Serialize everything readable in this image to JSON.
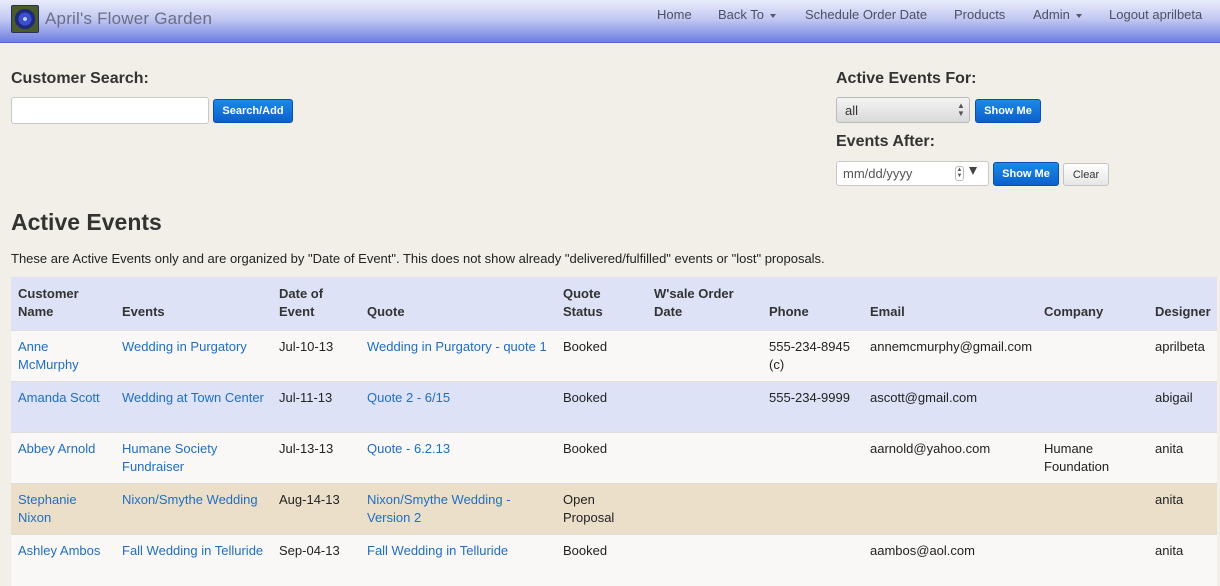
{
  "app": {
    "title": "April's Flower Garden"
  },
  "nav": {
    "home": "Home",
    "back_to": "Back To",
    "schedule": "Schedule Order Date",
    "products": "Products",
    "admin": "Admin",
    "logout": "Logout aprilbeta"
  },
  "customer_search": {
    "label": "Customer Search:",
    "value": "",
    "button": "Search/Add"
  },
  "active_events_for": {
    "label": "Active Events For:",
    "selected": "all",
    "button": "Show Me"
  },
  "events_after": {
    "label": "Events After:",
    "placeholder": "mm/dd/yyyy",
    "show_button": "Show Me",
    "clear_button": "Clear"
  },
  "page": {
    "title": "Active Events",
    "description": "These are Active Events only and are organized by \"Date of Event\". This does not show already \"delivered/fulfilled\" events or \"lost\" proposals."
  },
  "table": {
    "headers": {
      "customer": "Customer Name",
      "events": "Events",
      "date": "Date of Event",
      "quote": "Quote",
      "quote_status": "Quote Status",
      "wsale": "W'sale Order Date",
      "phone": "Phone",
      "email": "Email",
      "company": "Company",
      "designer": "Designer"
    },
    "rows": [
      {
        "customer": "Anne McMurphy",
        "event": "Wedding in Purgatory",
        "date": "Jul-10-13",
        "quote": "Wedding in Purgatory - quote 1",
        "status": "Booked",
        "wsale": "",
        "phone": "555-234-8945 (c)",
        "email": "annemcmurphy@gmail.com",
        "company": "",
        "designer": "aprilbeta"
      },
      {
        "customer": "Amanda Scott",
        "event": "Wedding at Town Center",
        "date": "Jul-11-13",
        "quote": "Quote 2 - 6/15",
        "status": "Booked",
        "wsale": "",
        "phone": "555-234-9999",
        "email": "ascott@gmail.com",
        "company": "",
        "designer": "abigail"
      },
      {
        "customer": "Abbey Arnold",
        "event": "Humane Society Fundraiser",
        "date": "Jul-13-13",
        "quote": "Quote - 6.2.13",
        "status": "Booked",
        "wsale": "",
        "phone": "",
        "email": "aarnold@yahoo.com",
        "company": "Humane Foundation",
        "designer": "anita"
      },
      {
        "customer": "Stephanie Nixon",
        "event": "Nixon/Smythe Wedding",
        "date": "Aug-14-13",
        "quote": "Nixon/Smythe Wedding - Version 2",
        "status": "Open Proposal",
        "wsale": "",
        "phone": "",
        "email": "",
        "company": "",
        "designer": "anita"
      },
      {
        "customer": "Ashley Ambos",
        "event": "Fall Wedding in Telluride",
        "date": "Sep-04-13",
        "quote": "Fall Wedding in Telluride",
        "status": "Booked",
        "wsale": "",
        "phone": "",
        "email": "aambos@aol.com",
        "company": "",
        "designer": "anita"
      }
    ]
  },
  "colors": {
    "accent": "#0c5fcd",
    "link": "#1f6ec2",
    "row_blue": "#dde2f6",
    "row_tan": "#ecdfca",
    "page_bg": "#f1efe8"
  }
}
